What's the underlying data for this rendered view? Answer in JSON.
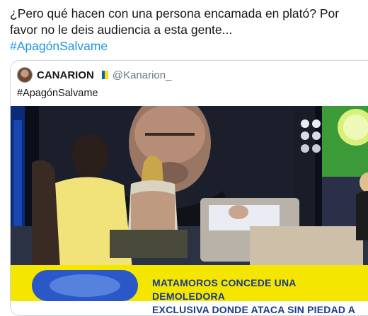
{
  "tweet": {
    "text_line1": "¿Pero qué hacen con una persona encamada en plató? Por",
    "text_line2": "favor no le deis audiencia a esta gente...",
    "hashtag": "#ApagónSalvame"
  },
  "quoted_tweet": {
    "display_name": "CANARION",
    "handle": "@Kanarion_",
    "text": "#ApagónSalvame",
    "flag_icon": "canary-islands-flag-icon",
    "media": {
      "banner_line1": "MATAMOROS CONCEDE UNA DEMOLEDORA",
      "banner_line2": "EXCLUSIVA DONDE ATACA SIN PIEDAD A SUS"
    }
  },
  "colors": {
    "hashtag": "#1b95e0",
    "text": "#14171a",
    "muted": "#657786",
    "border": "#ccd6dd",
    "banner_yellow": "#f5e600",
    "banner_text": "#1a3a8a"
  }
}
